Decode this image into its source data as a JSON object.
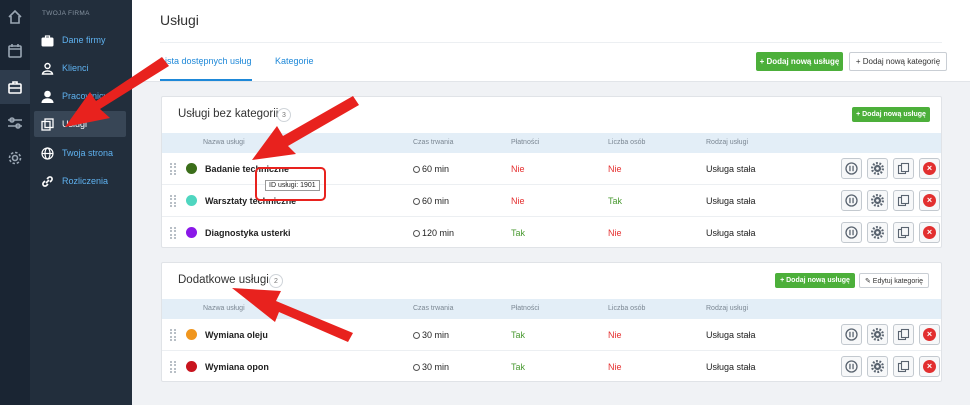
{
  "sidebar": {
    "section_label": "TWOJA FIRMA",
    "items": [
      {
        "label": "Dane firmy",
        "icon": "briefcase-icon"
      },
      {
        "label": "Klienci",
        "icon": "user-outline-icon"
      },
      {
        "label": "Pracownicy",
        "icon": "user-icon"
      },
      {
        "label": "Usługi",
        "icon": "copy-icon"
      },
      {
        "label": "Twoja strona",
        "icon": "globe-icon"
      },
      {
        "label": "Rozliczenia",
        "icon": "link-icon"
      }
    ]
  },
  "header": {
    "title": "Usługi",
    "tabs": [
      "Lista dostępnych usług",
      "Kategorie"
    ],
    "add_service_label": "+ Dodaj nową usługę",
    "add_category_label": "+ Dodaj nową kategorię"
  },
  "columns": [
    "Nazwa usługi",
    "Czas trwania",
    "Płatności",
    "Liczba osób",
    "Rodzaj usługi"
  ],
  "groups": [
    {
      "title": "Usługi bez kategorii",
      "count": "3",
      "add_label": "+ Dodaj nową usługę",
      "edit_label": "",
      "rows": [
        {
          "name": "Badanie techniczne",
          "color": "#3b6e1a",
          "duration": "60 min",
          "payment": "Nie",
          "persons": "Nie",
          "type": "Usługa stała"
        },
        {
          "name": "Warsztaty techniczne",
          "color": "#4fd6c0",
          "duration": "60 min",
          "payment": "Nie",
          "persons": "Tak",
          "type": "Usługa stała"
        },
        {
          "name": "Diagnostyka usterki",
          "color": "#8a18e8",
          "duration": "120 min",
          "payment": "Tak",
          "persons": "Nie",
          "type": "Usługa stała"
        }
      ]
    },
    {
      "title": "Dodatkowe usługi",
      "count": "2",
      "add_label": "+ Dodaj nową usługę",
      "edit_label": "✎ Edytuj kategorię",
      "rows": [
        {
          "name": "Wymiana oleju",
          "color": "#f0961e",
          "duration": "30 min",
          "payment": "Tak",
          "persons": "Nie",
          "type": "Usługa stała"
        },
        {
          "name": "Wymiana opon",
          "color": "#c8141e",
          "duration": "30 min",
          "payment": "Tak",
          "persons": "Nie",
          "type": "Usługa stała"
        }
      ]
    }
  ],
  "tooltip": "ID usługi: 1901",
  "colors": {
    "accent": "#1e88d8",
    "green": "#4caf3a",
    "red": "#e53030",
    "annotation": "#e8221e"
  }
}
